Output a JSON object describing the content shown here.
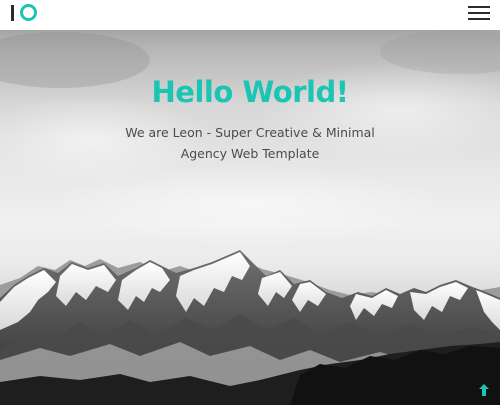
{
  "header": {
    "logo_icon": "io-logo-icon",
    "menu_icon": "hamburger-menu-icon"
  },
  "hero": {
    "title": "Hello World!",
    "subtitle": "We are Leon - Super Creative & Minimal Agency Web Template",
    "background": "snowy-mountains-photo"
  },
  "scroll_top": {
    "icon": "arrow-up-icon"
  },
  "colors": {
    "accent": "#1cc4b3",
    "text_dark": "#2b2b2b",
    "subtitle_text": "#4c4c4c",
    "header_bg": "#ffffff"
  }
}
